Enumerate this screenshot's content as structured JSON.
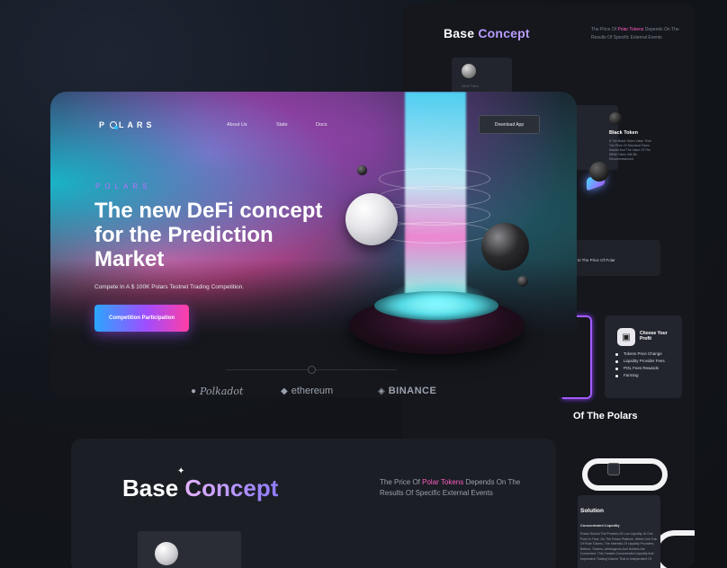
{
  "colors": {
    "accent_purple": "#b772ff",
    "accent_pink": "#ff3ea5",
    "accent_cyan": "#2aa6ff",
    "background": "#111317"
  },
  "right_board": {
    "title_base": "Base",
    "title_concept": "Concept",
    "subtitle_pre": "The Price Of ",
    "subtitle_highlight": "Polar Tokens",
    "subtitle_post": " Depends On The Results Of Specific External Events",
    "white_token_label": "White Token",
    "black_token_title": "Black Token",
    "black_token_text": "If The Black Token Value Then The Price Of Standard Token Market And The Value Of The White Token Will Be Decommissioned",
    "change_text": "nge In The Price Of Polar",
    "profit": {
      "icon": "wallet-icon",
      "title": "Choose Your Profit",
      "items": [
        "Tokens Price Change",
        "Liquidity Provider Fees",
        "POL Fees Rewards",
        "Farming"
      ]
    },
    "polars_heading": "Of The Polars",
    "solution": {
      "title": "Solution",
      "subtitle": "Concentrated Liquidity",
      "text": "Polars Solved The Problem Of Low Liquidity. At One Point In Time, On The Polars Platform, Within One Pair Of Polar Tokens, The Interests Of Liquidity Providers, Bettors, Traders, Arbitrageurs And Holders Are Connected. This Creates Concentrated Liquidity And Impressive Trading Volume That Is Independent Of"
    }
  },
  "bottom_board": {
    "title_base": "Base",
    "title_concept": "Concept",
    "subtitle_pre": "The Price Of ",
    "subtitle_highlight": "Polar Tokens",
    "subtitle_post": " Depends On The Results Of Specific External Events"
  },
  "hero": {
    "logo": "POLARS",
    "nav": [
      "About Us",
      "Stats",
      "Docs"
    ],
    "download_button": "Download App",
    "eyebrow": "POLARS",
    "headline": "The new DeFi concept for the Prediction Market",
    "tagline": "Compete In A $ 100K Polars Testnet Trading Competition.",
    "cta": "Competition Participation",
    "partners": [
      {
        "name": "Polkadot",
        "icon": "polkadot-icon",
        "glyph": "●"
      },
      {
        "name": "ethereum",
        "icon": "ethereum-icon",
        "glyph": "◆"
      },
      {
        "name": "BINANCE",
        "icon": "binance-icon",
        "glyph": "◈"
      }
    ]
  }
}
